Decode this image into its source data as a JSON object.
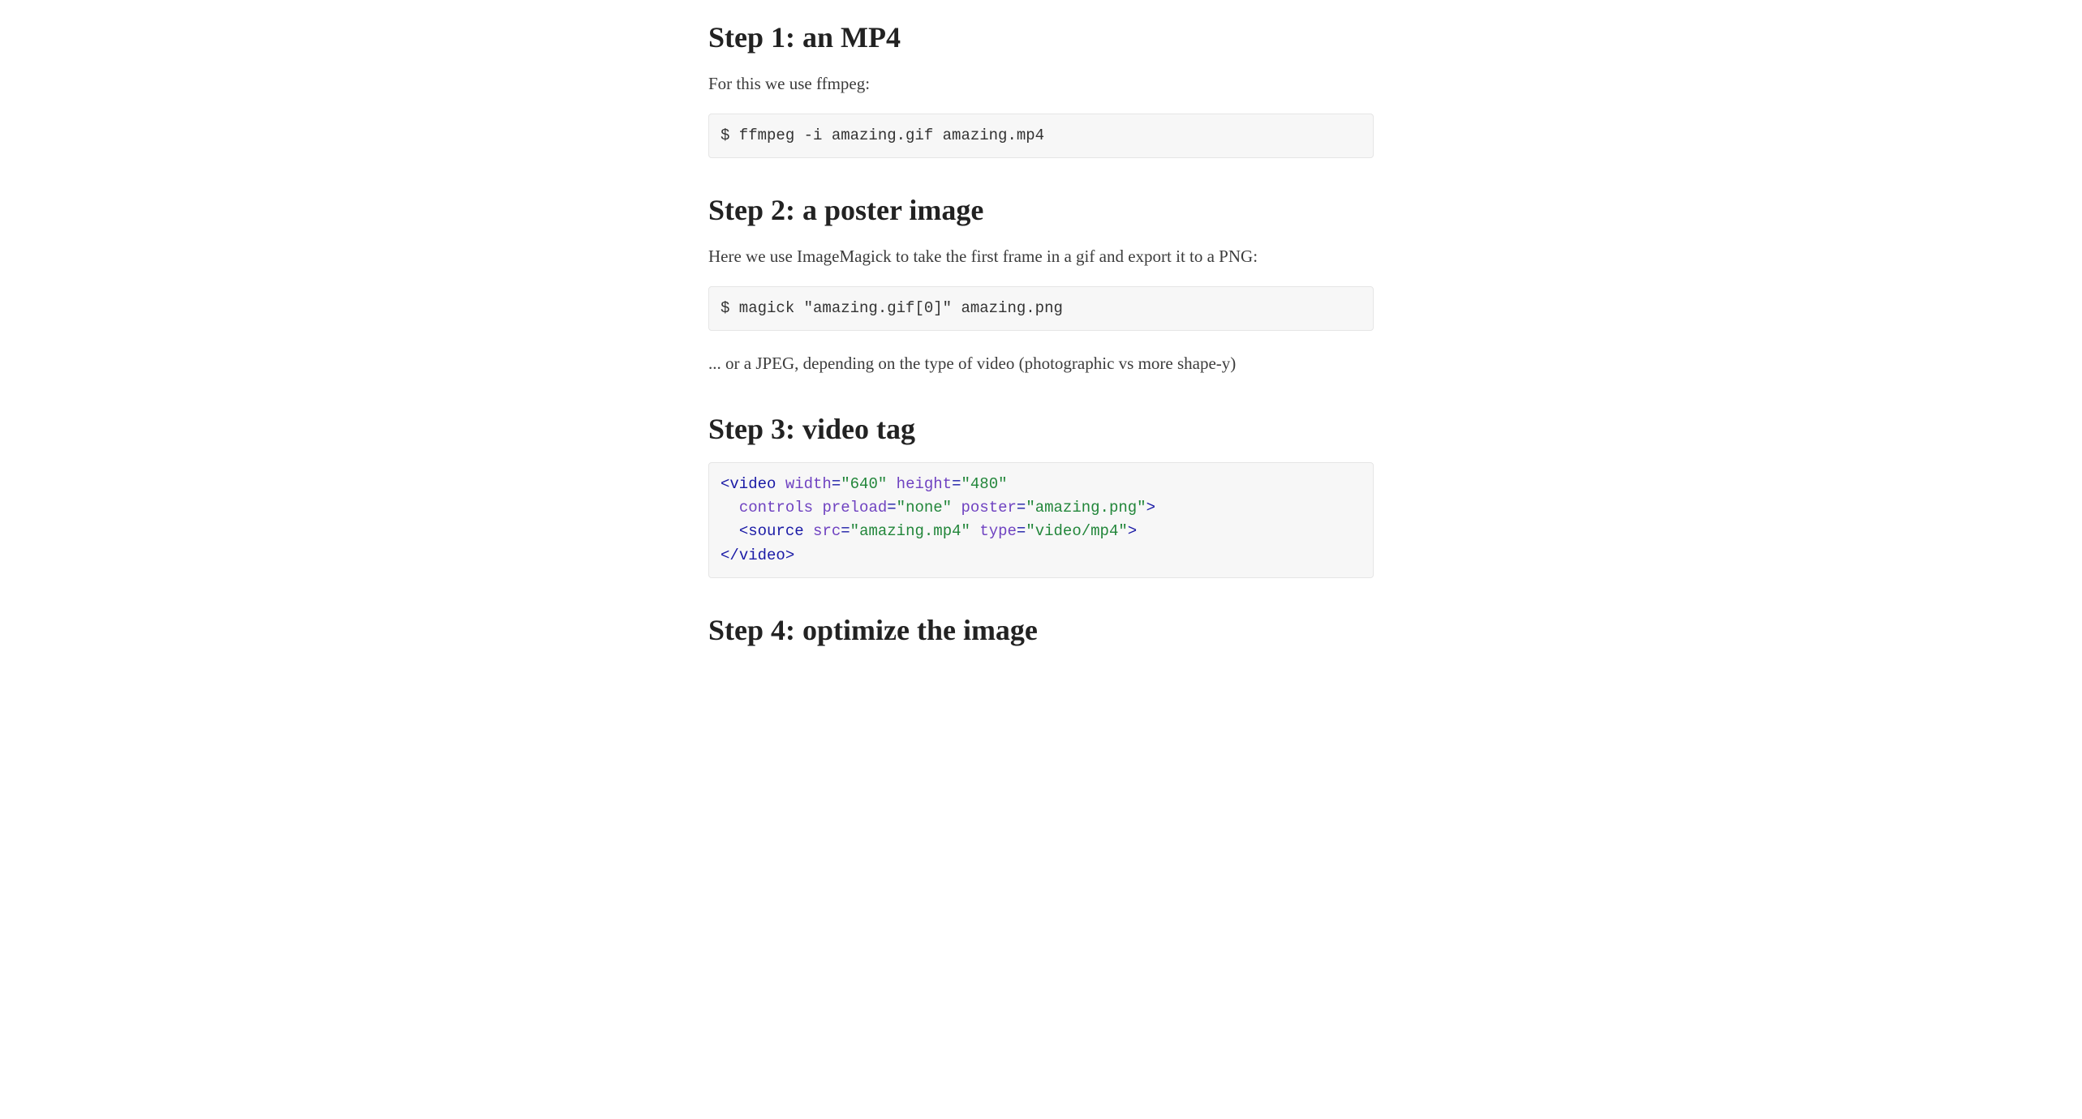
{
  "step1": {
    "heading": "Step 1: an MP4",
    "intro": "For this we use ffmpeg:",
    "code": "$ ffmpeg -i amazing.gif amazing.mp4"
  },
  "step2": {
    "heading": "Step 2: a poster image",
    "intro": "Here we use ImageMagick to take the first frame in a gif and export it to a PNG:",
    "code": "$ magick \"amazing.gif[0]\" amazing.png",
    "outro": "... or a JPEG, depending on the type of video (photographic vs more shape-y)"
  },
  "step3": {
    "heading": "Step 3: video tag",
    "html_block": {
      "tag_video_open": "video",
      "attr_width_name": "width",
      "attr_width_val": "\"640\"",
      "attr_height_name": "height",
      "attr_height_val": "\"480\"",
      "attr_controls": "controls",
      "attr_preload_name": "preload",
      "attr_preload_val": "\"none\"",
      "attr_poster_name": "poster",
      "attr_poster_val": "\"amazing.png\"",
      "tag_source": "source",
      "attr_src_name": "src",
      "attr_src_val": "\"amazing.mp4\"",
      "attr_type_name": "type",
      "attr_type_val": "\"video/mp4\"",
      "tag_video_close": "video"
    }
  },
  "step4": {
    "heading": "Step 4: optimize the image"
  }
}
